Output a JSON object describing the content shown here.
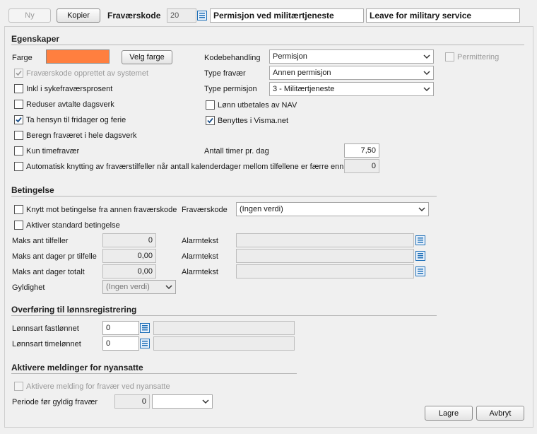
{
  "toolbar": {
    "new_label": "Ny",
    "copy_label": "Kopier",
    "code_label": "Fraværskode",
    "code_value": "20",
    "name_no": "Permisjon ved militærtjeneste",
    "name_en": "Leave for military service"
  },
  "properties": {
    "title": "Egenskaper",
    "color_label": "Farge",
    "color_value": "#ff7f3f",
    "choose_color_label": "Velg farge",
    "created_by_system": "Fraværskode opprettet av systemet",
    "include_sick": "Inkl i sykefraværsprosent",
    "reduce_workday": "Reduser avtalte dagsverk",
    "consider_holidays": "Ta hensyn til fridager og ferie",
    "calc_whole_day": "Beregn fraværet i hele dagsverk",
    "hourly_only": "Kun timefravær",
    "auto_link": "Automatisk knytting av fraværstilfeller når antall kalenderdager mellom tilfellene er færre enn",
    "auto_link_value": "0",
    "code_handling_label": "Kodebehandling",
    "code_handling_value": "Permisjon",
    "layoff_label": "Permittering",
    "absence_type_label": "Type fravær",
    "absence_type_value": "Annen permisjon",
    "leave_type_label": "Type permisjon",
    "leave_type_value": "3 - Militærtjeneste",
    "nav_pays": "Lønn utbetales av NAV",
    "used_in_visma": "Benyttes i Visma.net",
    "hours_per_day_label": "Antall timer pr. dag",
    "hours_per_day_value": "7,50"
  },
  "condition": {
    "title": "Betingelse",
    "link_condition": "Knytt mot betingelse fra annen fraværskode",
    "code_label": "Fraværskode",
    "code_value": "(Ingen verdi)",
    "activate_standard": "Aktiver standard betingelse",
    "max_cases_label": "Maks ant tilfeller",
    "max_cases_value": "0",
    "max_days_per_case_label": "Maks ant dager pr tilfelle",
    "max_days_per_case_value": "0,00",
    "max_days_total_label": "Maks ant dager totalt",
    "max_days_total_value": "0,00",
    "alarm_label_1": "Alarmtekst",
    "alarm_label_2": "Alarmtekst",
    "alarm_label_3": "Alarmtekst",
    "validity_label": "Gyldighet",
    "validity_value": "(Ingen verdi)"
  },
  "payroll": {
    "title": "Overføring til lønnsregistrering",
    "fixed_label": "Lønnsart fastlønnet",
    "fixed_value": "0",
    "hourly_label": "Lønnsart timelønnet",
    "hourly_value": "0"
  },
  "new_hires": {
    "title": "Aktivere meldinger for nyansatte",
    "activate_message": "Aktivere melding for fravær ved nyansatte",
    "period_label": "Periode før gyldig fravær",
    "period_value": "0"
  },
  "footer": {
    "save_label": "Lagre",
    "cancel_label": "Avbryt"
  },
  "colors": {
    "accent_blue": "#1e6fb7",
    "check_mark": "#1a4f8a"
  }
}
